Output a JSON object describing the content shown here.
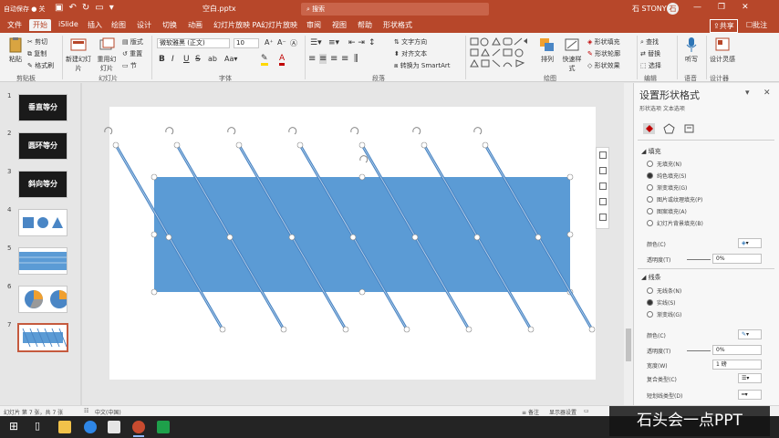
{
  "titlebar": {
    "autosave": "自动保存 ● 关",
    "filename": "空白.pptx",
    "search_placeholder": "搜索",
    "user": "石 STONY",
    "avatar": "石",
    "minimize": "—",
    "restore": "❐",
    "close": "✕"
  },
  "tabs": [
    "文件",
    "开始",
    "iSlide",
    "插入",
    "绘图",
    "设计",
    "切换",
    "动画",
    "幻灯片放映 PA",
    "幻灯片放映",
    "审阅",
    "视图",
    "帮助",
    "形状格式"
  ],
  "active_tab": "开始",
  "share": "共享",
  "comments": "批注",
  "ribbon": {
    "paste": "粘贴",
    "cut": "剪切",
    "copy": "复制",
    "format_painter": "格式刷",
    "new_slide": "新建幻灯片",
    "reuse_slides": "重用幻灯片",
    "layout": "版式",
    "reset": "重置",
    "section": "节",
    "font_name": "微软雅黑 (正文)",
    "font_size": "10",
    "bold": "B",
    "italic": "I",
    "underline": "U",
    "strike": "S",
    "text_dir": "文字方向",
    "align_text": "对齐文本",
    "smartart": "转换为 SmartArt",
    "arrange": "排列",
    "quick_styles": "快速样式",
    "shape_fill": "形状填充",
    "shape_outline": "形状轮廓",
    "shape_effects": "形状效果",
    "find": "查找",
    "replace": "替换",
    "select": "选择",
    "dictate": "听写",
    "design_ideas": "设计灵感",
    "grp_clipboard": "剪贴板",
    "grp_slides": "幻灯片",
    "grp_font": "字体",
    "grp_paragraph": "段落",
    "grp_drawing": "绘图",
    "grp_editing": "编辑",
    "grp_voice": "语音",
    "grp_designer": "设计器"
  },
  "thumbs": [
    {
      "num": "1",
      "label": "垂直等分"
    },
    {
      "num": "2",
      "label": "圆环等分"
    },
    {
      "num": "3",
      "label": "斜向等分"
    },
    {
      "num": "4",
      "label": ""
    },
    {
      "num": "5",
      "label": ""
    },
    {
      "num": "6",
      "label": ""
    },
    {
      "num": "7",
      "label": ""
    }
  ],
  "pane": {
    "title": "设置形状格式",
    "close": "✕",
    "tabs": "形状选项   文本选项",
    "sec_fill": "◢ 填充",
    "fill_options": [
      "无填充(N)",
      "纯色填充(S)",
      "渐变填充(G)",
      "图片或纹理填充(P)",
      "图案填充(A)",
      "幻灯片背景填充(B)"
    ],
    "color_label": "颜色(C)",
    "transparency_label": "透明度(T)",
    "transparency_value": "0%",
    "sec_line": "◢ 线条",
    "line_options": [
      "无线条(N)",
      "实线(S)",
      "渐变线(G)"
    ],
    "line_color_label": "颜色(C)",
    "line_transparency_label": "透明度(T)",
    "line_transparency_value": "0%",
    "width_label": "宽度(W)",
    "width_value": "1 磅",
    "compound_label": "复合类型(C)",
    "dash_label": "短划线类型(D)"
  },
  "status": {
    "slide_info": "幻灯片 第 7 张，共 7 张",
    "lang": "中文(中国)",
    "notes": "备注",
    "display": "显示器设置"
  },
  "watermark": "石头会一点PPT",
  "colors": {
    "accent": "#b7472a",
    "shape": "#5b9bd5",
    "line": "#4a86c5"
  }
}
